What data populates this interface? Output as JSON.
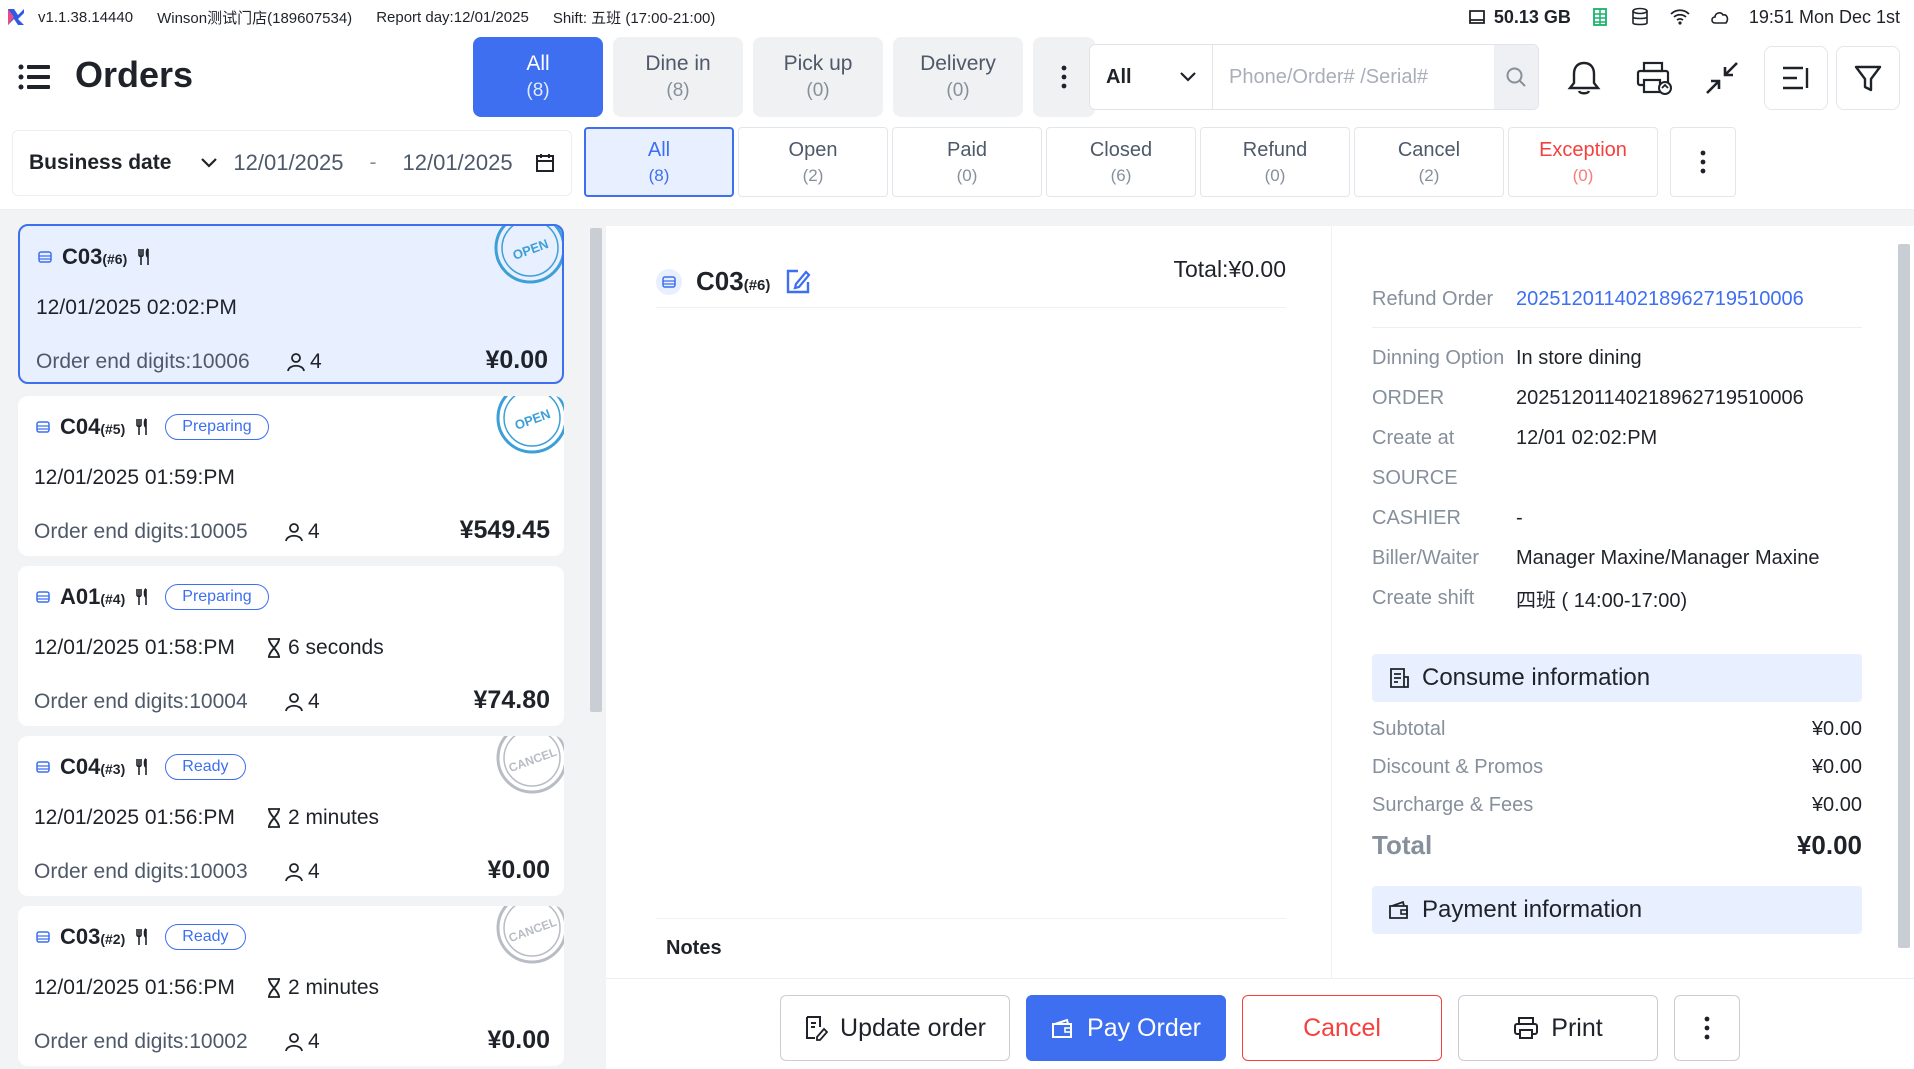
{
  "status_bar": {
    "version": "v1.1.38.14440",
    "store": "Winson测试门店(189607534)",
    "report_day": "Report day:12/01/2025",
    "shift": "Shift: 五班 (17:00-21:00)",
    "storage": "50.13 GB",
    "datetime": "19:51 Mon Dec 1st"
  },
  "header": {
    "title": "Orders",
    "order_types": [
      {
        "label": "All",
        "count": "(8)"
      },
      {
        "label": "Dine in",
        "count": "(8)"
      },
      {
        "label": "Pick up",
        "count": "(0)"
      },
      {
        "label": "Delivery",
        "count": "(0)"
      }
    ],
    "search": {
      "select_value": "All",
      "placeholder": "Phone/Order# /Serial#"
    }
  },
  "filters": {
    "date_label": "Business date",
    "date_from": "12/01/2025",
    "date_sep": "-",
    "date_to": "12/01/2025",
    "statuses": [
      {
        "label": "All",
        "count": "(8)"
      },
      {
        "label": "Open",
        "count": "(2)"
      },
      {
        "label": "Paid",
        "count": "(0)"
      },
      {
        "label": "Closed",
        "count": "(6)"
      },
      {
        "label": "Refund",
        "count": "(0)"
      },
      {
        "label": "Cancel",
        "count": "(2)"
      },
      {
        "label": "Exception",
        "count": "(0)"
      }
    ]
  },
  "orders": [
    {
      "table": "C03",
      "num": "(#6)",
      "badge": "",
      "time": "12/01/2025 02:02:PM",
      "elapsed": "",
      "digits": "Order end digits:10006",
      "guests": "4",
      "amount": "¥0.00",
      "stamp": "OPEN"
    },
    {
      "table": "C04",
      "num": "(#5)",
      "badge": "Preparing",
      "time": "12/01/2025 01:59:PM",
      "elapsed": "",
      "digits": "Order end digits:10005",
      "guests": "4",
      "amount": "¥549.45",
      "stamp": "OPEN"
    },
    {
      "table": "A01",
      "num": "(#4)",
      "badge": "Preparing",
      "time": "12/01/2025 01:58:PM",
      "elapsed": "6 seconds",
      "digits": "Order end digits:10004",
      "guests": "4",
      "amount": "¥74.80",
      "stamp": ""
    },
    {
      "table": "C04",
      "num": "(#3)",
      "badge": "Ready",
      "time": "12/01/2025 01:56:PM",
      "elapsed": "2 minutes",
      "digits": "Order end digits:10003",
      "guests": "4",
      "amount": "¥0.00",
      "stamp": "CANCEL"
    },
    {
      "table": "C03",
      "num": "(#2)",
      "badge": "Ready",
      "time": "12/01/2025 01:56:PM",
      "elapsed": "2 minutes",
      "digits": "Order end digits:10002",
      "guests": "4",
      "amount": "¥0.00",
      "stamp": "CANCEL"
    }
  ],
  "detail": {
    "table": "C03",
    "num": "(#6)",
    "total": "Total:¥0.00",
    "notes_label": "Notes",
    "refund_label": "Refund Order",
    "refund_value": "20251201140218962719510006",
    "fields": [
      {
        "k": "Dinning Option",
        "v": "In store dining"
      },
      {
        "k": "ORDER",
        "v": "20251201140218962719510006"
      },
      {
        "k": "Create at",
        "v": "12/01 02:02:PM"
      },
      {
        "k": "SOURCE",
        "v": ""
      },
      {
        "k": "CASHIER",
        "v": "-"
      },
      {
        "k": "Biller/Waiter",
        "v": "Manager Maxine/Manager Maxine"
      },
      {
        "k": "Create shift",
        "v": "四班 ( 14:00-17:00)"
      }
    ],
    "consume_title": "Consume information",
    "subtotal_label": "Subtotal",
    "subtotal": "¥0.00",
    "discount_label": "Discount & Promos",
    "discount": "¥0.00",
    "surcharge_label": "Surcharge & Fees",
    "surcharge": "¥0.00",
    "total_label": "Total",
    "total_value": "¥0.00",
    "payment_title": "Payment information"
  },
  "actions": {
    "update": "Update order",
    "pay": "Pay Order",
    "cancel": "Cancel",
    "print": "Print"
  },
  "colors": {
    "primary": "#3d6ff0",
    "danger": "#f5403d"
  }
}
